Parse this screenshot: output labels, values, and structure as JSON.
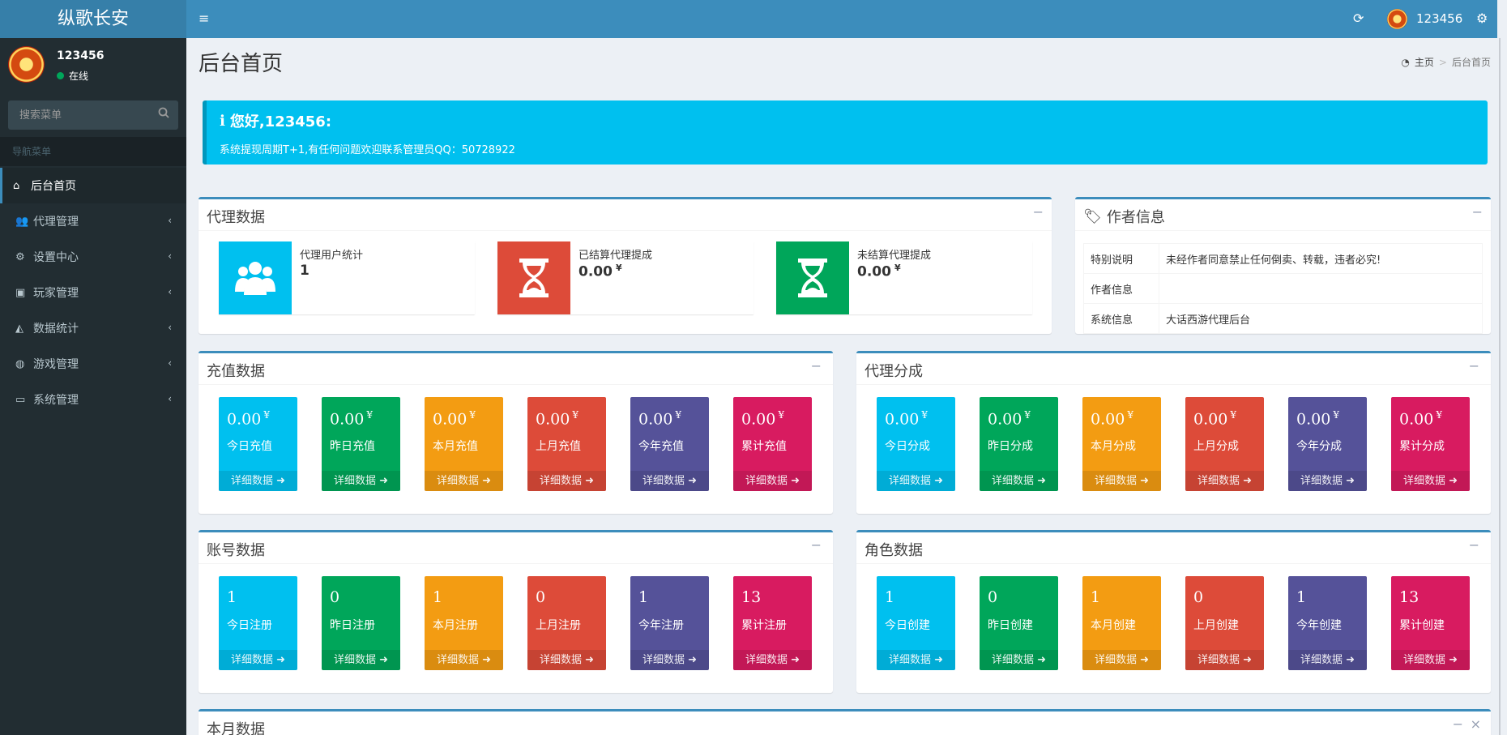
{
  "app": {
    "title": "纵歌长安"
  },
  "topbar": {
    "username": "123456"
  },
  "sidebar": {
    "user": {
      "name": "123456",
      "status": "在线"
    },
    "search_placeholder": "搜索菜单",
    "header": "导航菜单",
    "items": [
      {
        "label": "后台首页",
        "icon": "home-icon",
        "active": true
      },
      {
        "label": "代理管理",
        "icon": "users-icon"
      },
      {
        "label": "设置中心",
        "icon": "cogs-icon"
      },
      {
        "label": "玩家管理",
        "icon": "address-book-icon"
      },
      {
        "label": "数据统计",
        "icon": "area-chart-icon"
      },
      {
        "label": "游戏管理",
        "icon": "gamepad-icon"
      },
      {
        "label": "系统管理",
        "icon": "desktop-icon"
      }
    ]
  },
  "page": {
    "title": "后台首页"
  },
  "breadcrumb": {
    "home": "主页",
    "current": "后台首页"
  },
  "callout": {
    "title": "您好,123456:",
    "text": "系统提现周期T+1,有任何问题欢迎联系管理员QQ：50728922"
  },
  "agent_data": {
    "title": "代理数据",
    "boxes": [
      {
        "label": "代理用户统计",
        "value": "1",
        "unit": "",
        "color": "#00c0ef",
        "icon": "users-icon"
      },
      {
        "label": "已结算代理提成",
        "value": "0.00",
        "unit": "¥",
        "color": "#dd4b39",
        "icon": "hourglass-icon"
      },
      {
        "label": "未结算代理提成",
        "value": "0.00",
        "unit": "¥",
        "color": "#00a65a",
        "icon": "hourglass-icon"
      }
    ]
  },
  "author_info": {
    "title": "作者信息",
    "rows": [
      {
        "key": "特别说明",
        "value": "未经作者同意禁止任何倒卖、转载，违者必究!"
      },
      {
        "key": "作者信息",
        "value": ""
      },
      {
        "key": "系统信息",
        "value": "大话西游代理后台"
      }
    ]
  },
  "detail_label": "详细数据",
  "recharge": {
    "title": "充值数据",
    "boxes": [
      {
        "value": "0.00",
        "unit": "¥",
        "label": "今日充值",
        "color": "#00c0ef"
      },
      {
        "value": "0.00",
        "unit": "¥",
        "label": "昨日充值",
        "color": "#00a65a"
      },
      {
        "value": "0.00",
        "unit": "¥",
        "label": "本月充值",
        "color": "#f39c12"
      },
      {
        "value": "0.00",
        "unit": "¥",
        "label": "上月充值",
        "color": "#dd4b39"
      },
      {
        "value": "0.00",
        "unit": "¥",
        "label": "今年充值",
        "color": "#555299"
      },
      {
        "value": "0.00",
        "unit": "¥",
        "label": "累计充值",
        "color": "#d81b60"
      }
    ]
  },
  "commission": {
    "title": "代理分成",
    "boxes": [
      {
        "value": "0.00",
        "unit": "¥",
        "label": "今日分成",
        "color": "#00c0ef"
      },
      {
        "value": "0.00",
        "unit": "¥",
        "label": "昨日分成",
        "color": "#00a65a"
      },
      {
        "value": "0.00",
        "unit": "¥",
        "label": "本月分成",
        "color": "#f39c12"
      },
      {
        "value": "0.00",
        "unit": "¥",
        "label": "上月分成",
        "color": "#dd4b39"
      },
      {
        "value": "0.00",
        "unit": "¥",
        "label": "今年分成",
        "color": "#555299"
      },
      {
        "value": "0.00",
        "unit": "¥",
        "label": "累计分成",
        "color": "#d81b60"
      }
    ]
  },
  "accounts": {
    "title": "账号数据",
    "boxes": [
      {
        "value": "1",
        "unit": "",
        "label": "今日注册",
        "color": "#00c0ef"
      },
      {
        "value": "0",
        "unit": "",
        "label": "昨日注册",
        "color": "#00a65a"
      },
      {
        "value": "1",
        "unit": "",
        "label": "本月注册",
        "color": "#f39c12"
      },
      {
        "value": "0",
        "unit": "",
        "label": "上月注册",
        "color": "#dd4b39"
      },
      {
        "value": "1",
        "unit": "",
        "label": "今年注册",
        "color": "#555299"
      },
      {
        "value": "13",
        "unit": "",
        "label": "累计注册",
        "color": "#d81b60"
      }
    ]
  },
  "roles": {
    "title": "角色数据",
    "boxes": [
      {
        "value": "1",
        "unit": "",
        "label": "今日创建",
        "color": "#00c0ef"
      },
      {
        "value": "0",
        "unit": "",
        "label": "昨日创建",
        "color": "#00a65a"
      },
      {
        "value": "1",
        "unit": "",
        "label": "本月创建",
        "color": "#f39c12"
      },
      {
        "value": "0",
        "unit": "",
        "label": "上月创建",
        "color": "#dd4b39"
      },
      {
        "value": "1",
        "unit": "",
        "label": "今年创建",
        "color": "#555299"
      },
      {
        "value": "13",
        "unit": "",
        "label": "累计创建",
        "color": "#d81b60"
      }
    ]
  },
  "monthly": {
    "title": "本月数据"
  }
}
